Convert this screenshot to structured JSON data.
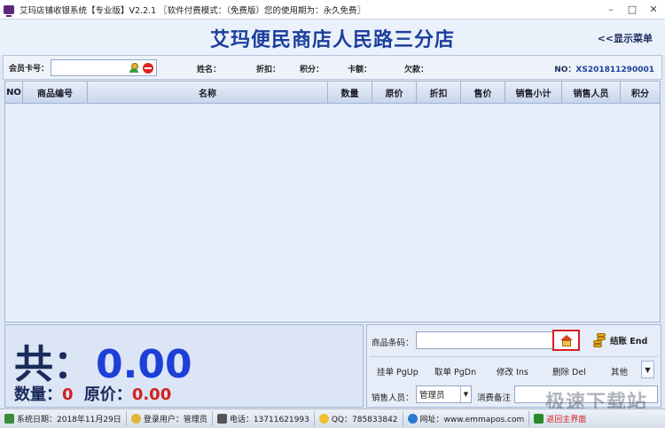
{
  "window": {
    "title": "艾玛店铺收银系统【专业版】V2.2.1 〖软件付费模式：（免费版）您的使用期为：永久免费〗"
  },
  "header": {
    "store_name": "艾玛便民商店人民路三分店",
    "menu_toggle": "<<显示菜单"
  },
  "member": {
    "card_label": "会员卡号：",
    "card_value": "",
    "name_label": "姓名：",
    "discount_label": "折扣：",
    "points_label": "积分：",
    "balance_label": "卡额：",
    "owed_label": "欠款：",
    "order_no_label": "NO：",
    "order_no": "XS201811290001"
  },
  "table": {
    "columns": [
      "NO",
      "商品编号",
      "名称",
      "数量",
      "原价",
      "折扣",
      "售价",
      "销售小计",
      "销售人员",
      "积分"
    ],
    "rows": []
  },
  "summary": {
    "total_label": "共：",
    "total_value": "0.00",
    "qty_label": "数量：",
    "qty_value": "0",
    "orig_label": "原价：",
    "orig_value": "0.00"
  },
  "controls": {
    "barcode_label": "商品条码：",
    "barcode_value": "",
    "checkout_label": "结账 End",
    "buttons": {
      "hold": "挂单 PgUp",
      "retrieve": "取单 PgDn",
      "edit": "修改 Ins",
      "delete": "删除 Del",
      "other": "其他"
    },
    "staff_label": "销售人员：",
    "staff_value": "管理员",
    "remark_label": "消费备注",
    "remark_value": ""
  },
  "watermark": "极速下载站",
  "status": {
    "date": "系统日期：2018年11月29日",
    "user": "登录用户：管理员",
    "phone": "电话：13711621993",
    "qq": "QQ：785833842",
    "website": "网址：www.emmapos.com",
    "return": "返回主界面"
  },
  "colors": {
    "title_blue": "#1c3f9c",
    "total_blue": "#1d3fd8",
    "accent_red": "#d42020"
  }
}
